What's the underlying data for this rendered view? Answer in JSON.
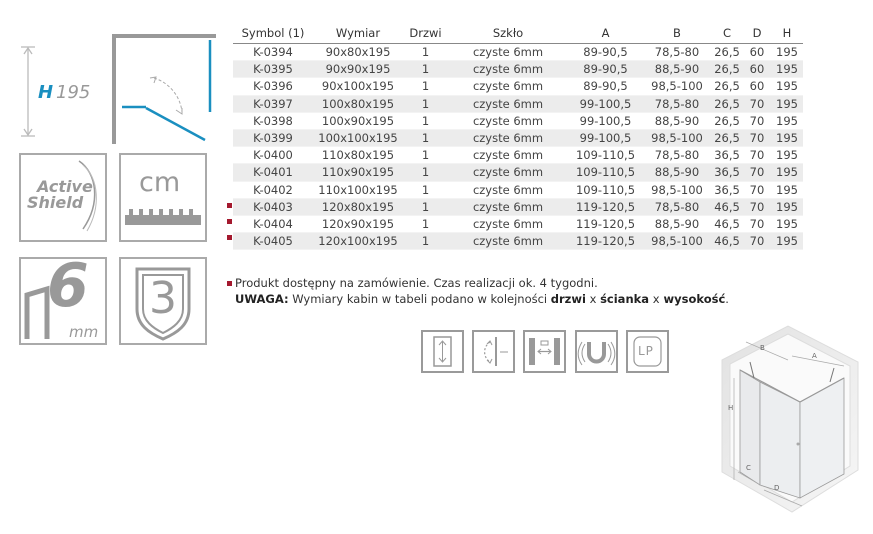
{
  "left": {
    "height_label": "H",
    "height_value": "195",
    "active_shield": [
      "Active",
      "Shield"
    ],
    "cm_label": "cm",
    "glass_thickness": "6",
    "glass_unit": "mm",
    "guarantee": "3"
  },
  "table": {
    "headers": [
      "Symbol (1)",
      "Wymiar",
      "Drzwi",
      "Szkło",
      "A",
      "B",
      "C",
      "D",
      "H"
    ],
    "rows": [
      {
        "marked": false,
        "cells": [
          "K-0394",
          "90x80x195",
          "1",
          "czyste 6mm",
          "89-90,5",
          "78,5-80",
          "26,5",
          "60",
          "195"
        ]
      },
      {
        "marked": false,
        "cells": [
          "K-0395",
          "90x90x195",
          "1",
          "czyste 6mm",
          "89-90,5",
          "88,5-90",
          "26,5",
          "60",
          "195"
        ]
      },
      {
        "marked": false,
        "cells": [
          "K-0396",
          "90x100x195",
          "1",
          "czyste 6mm",
          "89-90,5",
          "98,5-100",
          "26,5",
          "60",
          "195"
        ]
      },
      {
        "marked": false,
        "cells": [
          "K-0397",
          "100x80x195",
          "1",
          "czyste 6mm",
          "99-100,5",
          "78,5-80",
          "26,5",
          "70",
          "195"
        ]
      },
      {
        "marked": false,
        "cells": [
          "K-0398",
          "100x90x195",
          "1",
          "czyste 6mm",
          "99-100,5",
          "88,5-90",
          "26,5",
          "70",
          "195"
        ]
      },
      {
        "marked": false,
        "cells": [
          "K-0399",
          "100x100x195",
          "1",
          "czyste 6mm",
          "99-100,5",
          "98,5-100",
          "26,5",
          "70",
          "195"
        ]
      },
      {
        "marked": false,
        "cells": [
          "K-0400",
          "110x80x195",
          "1",
          "czyste 6mm",
          "109-110,5",
          "78,5-80",
          "36,5",
          "70",
          "195"
        ]
      },
      {
        "marked": false,
        "cells": [
          "K-0401",
          "110x90x195",
          "1",
          "czyste 6mm",
          "109-110,5",
          "88,5-90",
          "36,5",
          "70",
          "195"
        ]
      },
      {
        "marked": false,
        "cells": [
          "K-0402",
          "110x100x195",
          "1",
          "czyste 6mm",
          "109-110,5",
          "98,5-100",
          "36,5",
          "70",
          "195"
        ]
      },
      {
        "marked": true,
        "cells": [
          "K-0403",
          "120x80x195",
          "1",
          "czyste 6mm",
          "119-120,5",
          "78,5-80",
          "46,5",
          "70",
          "195"
        ]
      },
      {
        "marked": true,
        "cells": [
          "K-0404",
          "120x90x195",
          "1",
          "czyste 6mm",
          "119-120,5",
          "88,5-90",
          "46,5",
          "70",
          "195"
        ]
      },
      {
        "marked": true,
        "cells": [
          "K-0405",
          "120x100x195",
          "1",
          "czyste 6mm",
          "119-120,5",
          "98,5-100",
          "46,5",
          "70",
          "195"
        ]
      }
    ]
  },
  "notes": {
    "availability": "Produkt dostępny na zamówienie. Czas realizacji ok. 4 tygodni.",
    "warning_label": "UWAGA:",
    "warning_text": "Wymiary kabin w tabeli podano w kolejności",
    "word_drzwi": "drzwi",
    "sep1": "x",
    "word_scianka": "ścianka",
    "sep2": "x",
    "word_wysokosc": "wysokość",
    "period": "."
  },
  "feature_icons": {
    "lp_label": "LP"
  },
  "diagram": {
    "label_a": "A",
    "label_b": "B",
    "label_c": "C",
    "label_d": "D",
    "label_h": "H"
  },
  "colors": {
    "accent_blue": "#1a8fc0",
    "marker_red": "#a4192e",
    "icon_gray": "#9a9a9a"
  }
}
